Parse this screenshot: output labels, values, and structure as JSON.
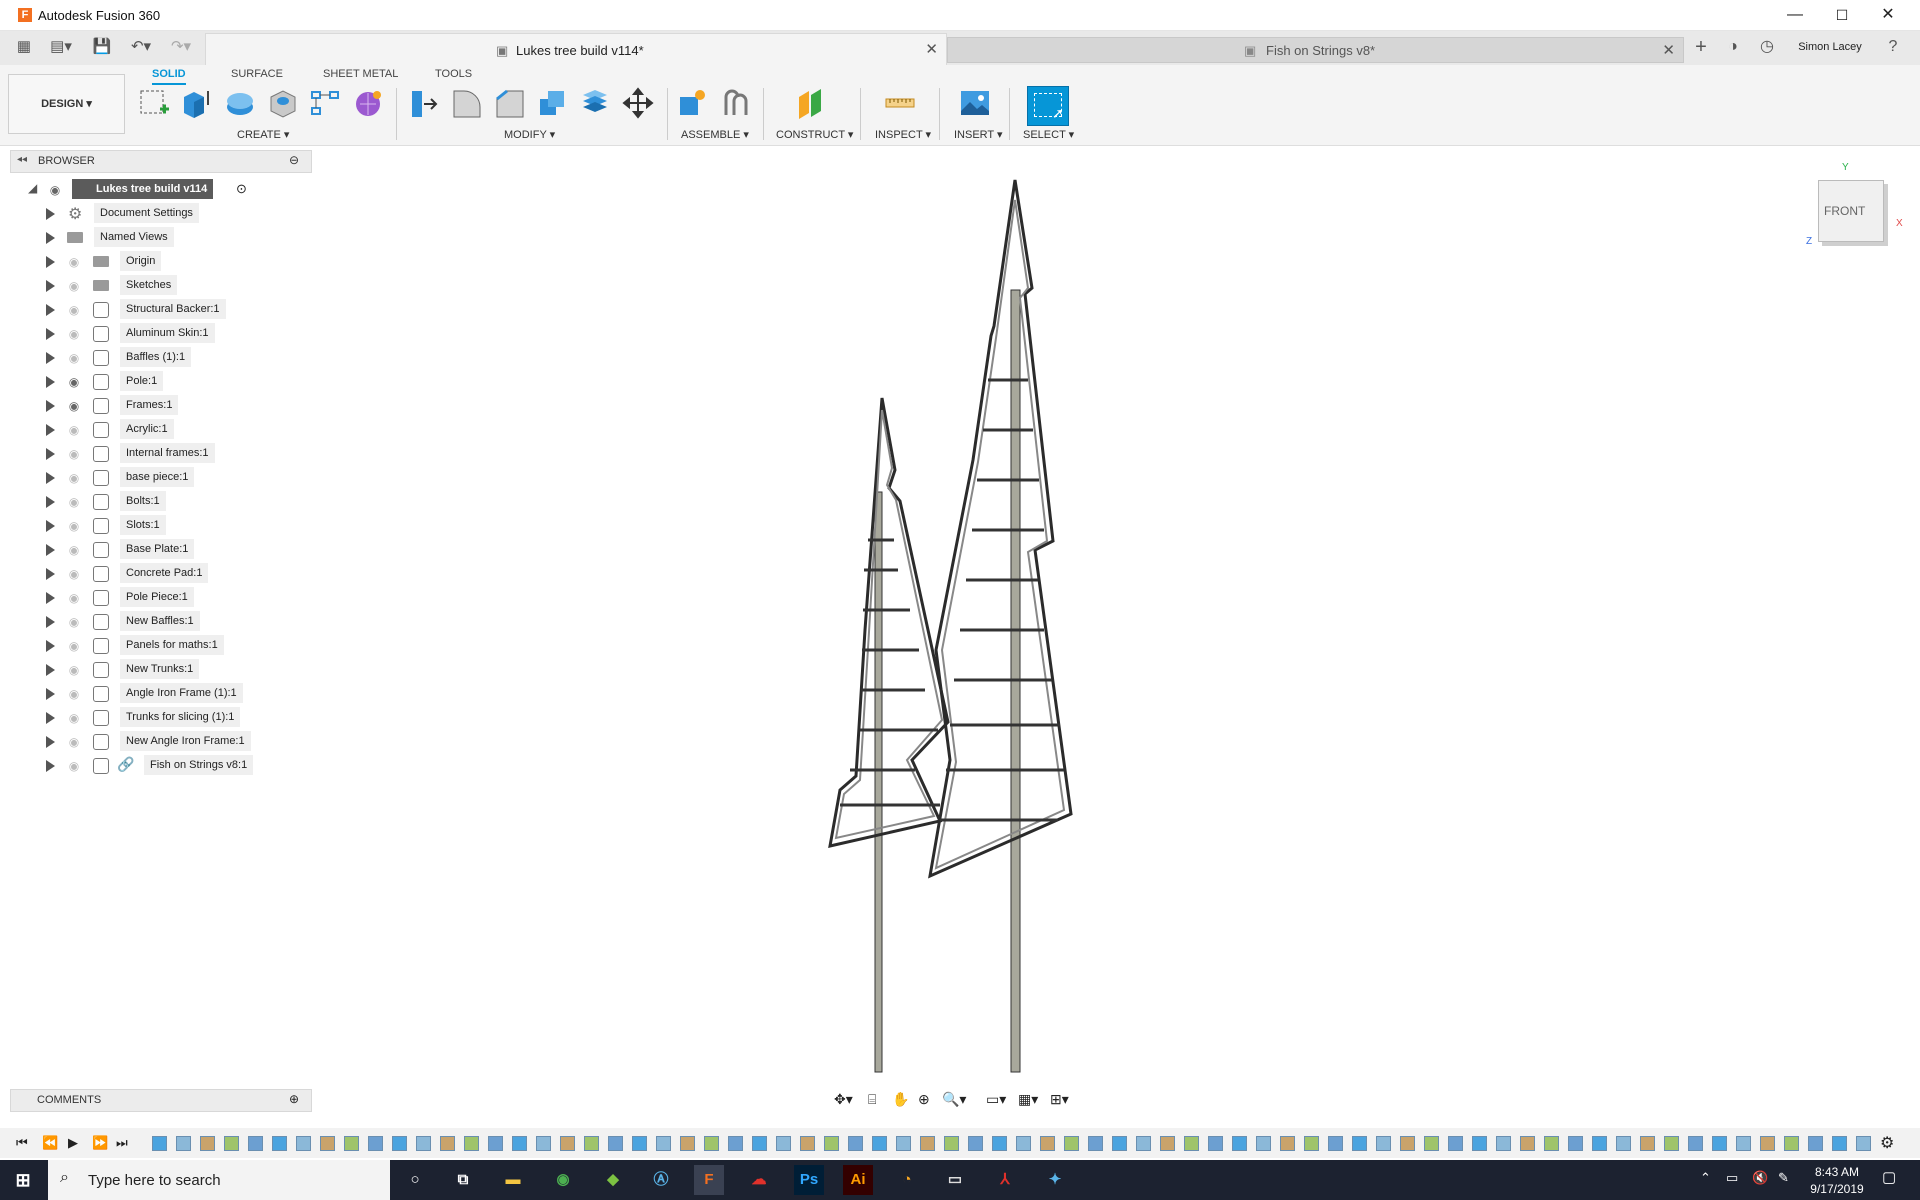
{
  "window": {
    "title": "Autodesk Fusion 360",
    "logo_letter": "F",
    "min": "—",
    "max": "☐",
    "close": "✕"
  },
  "tabs": [
    {
      "label": "Lukes tree build v114*",
      "close": "✕"
    },
    {
      "label": "Fish on Strings v8*",
      "close": "✕"
    }
  ],
  "user": {
    "name": "Simon Lacey",
    "add": "+"
  },
  "toolbar": {
    "design_label": "DESIGN ▾",
    "tabs": [
      "SOLID",
      "SURFACE",
      "SHEET METAL",
      "TOOLS"
    ],
    "groups": {
      "create": "CREATE ▾",
      "modify": "MODIFY ▾",
      "assemble": "ASSEMBLE ▾",
      "construct": "CONSTRUCT ▾",
      "inspect": "INSPECT ▾",
      "insert": "INSERT ▾",
      "select": "SELECT ▾"
    }
  },
  "browser": {
    "title": "BROWSER",
    "root": "Lukes tree build v114",
    "items": [
      {
        "label": "Document Settings",
        "icon": "gear"
      },
      {
        "label": "Named Views",
        "icon": "folder"
      },
      {
        "label": "Origin",
        "icon": "folder"
      },
      {
        "label": "Sketches",
        "icon": "folder"
      },
      {
        "label": "Structural Backer:1",
        "icon": "component"
      },
      {
        "label": "Aluminum Skin:1",
        "icon": "component"
      },
      {
        "label": "Baffles (1):1",
        "icon": "component"
      },
      {
        "label": "Pole:1",
        "icon": "component",
        "visible": true
      },
      {
        "label": "Frames:1",
        "icon": "component",
        "visible": true
      },
      {
        "label": "Acrylic:1",
        "icon": "component"
      },
      {
        "label": "Internal frames:1",
        "icon": "component"
      },
      {
        "label": "base piece:1",
        "icon": "component"
      },
      {
        "label": "Bolts:1",
        "icon": "component"
      },
      {
        "label": "Slots:1",
        "icon": "component"
      },
      {
        "label": "Base Plate:1",
        "icon": "component"
      },
      {
        "label": "Concrete Pad:1",
        "icon": "component"
      },
      {
        "label": "Pole Piece:1",
        "icon": "component"
      },
      {
        "label": "New Baffles:1",
        "icon": "component"
      },
      {
        "label": "Panels for maths:1",
        "icon": "component"
      },
      {
        "label": "New Trunks:1",
        "icon": "component"
      },
      {
        "label": "Angle Iron Frame (1):1",
        "icon": "component"
      },
      {
        "label": "Trunks for slicing (1):1",
        "icon": "component"
      },
      {
        "label": "New Angle Iron Frame:1",
        "icon": "component"
      },
      {
        "label": "Fish on Strings v8:1",
        "icon": "link"
      }
    ]
  },
  "viewcube": {
    "face": "FRONT",
    "x": "X",
    "y": "Y",
    "z": "Z"
  },
  "comments": {
    "title": "COMMENTS"
  },
  "taskbar": {
    "search_placeholder": "Type here to search",
    "time": "8:43 AM",
    "date": "9/17/2019",
    "apps": [
      {
        "letter": "Ps",
        "color": "#31a8ff"
      },
      {
        "letter": "Ai",
        "color": "#ff9a00"
      }
    ]
  }
}
